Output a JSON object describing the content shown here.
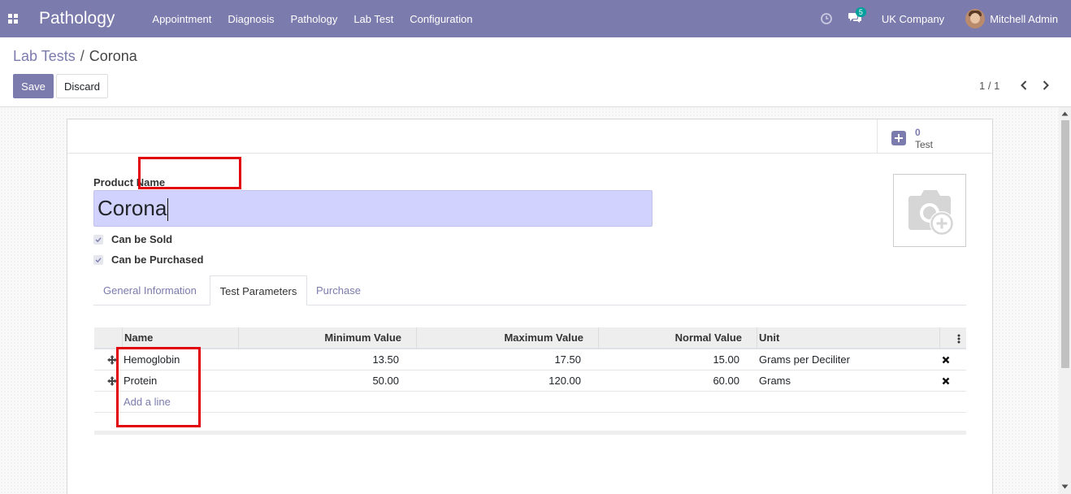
{
  "navbar": {
    "app_title": "Pathology",
    "menu": [
      "Appointment",
      "Diagnosis",
      "Pathology",
      "Lab Test",
      "Configuration"
    ],
    "chat_count": "5",
    "company": "UK Company",
    "user": "Mitchell Admin",
    "icons": {
      "apps": "apps-grid-icon",
      "activity": "clock-icon",
      "messages": "chat-icon"
    }
  },
  "control_panel": {
    "breadcrumb_parent": "Lab Tests",
    "breadcrumb_separator": "/",
    "breadcrumb_current": "Corona",
    "save_label": "Save",
    "discard_label": "Discard",
    "pager": "1 / 1"
  },
  "form": {
    "stat_button": {
      "value": "0",
      "label": "Test"
    },
    "product_name_label": "Product Name",
    "product_name": "Corona",
    "can_be_sold_label": "Can be Sold",
    "can_be_sold": true,
    "can_be_purchased_label": "Can be Purchased",
    "can_be_purchased": true,
    "tabs": [
      "General Information",
      "Test Parameters",
      "Purchase"
    ],
    "active_tab": "Test Parameters"
  },
  "parameters_table": {
    "columns": [
      "Name",
      "Minimum Value",
      "Maximum Value",
      "Normal Value",
      "Unit"
    ],
    "rows": [
      {
        "name": "Hemoglobin",
        "min": "13.50",
        "max": "17.50",
        "normal": "15.00",
        "unit": "Grams per Deciliter"
      },
      {
        "name": "Protein",
        "min": "50.00",
        "max": "120.00",
        "normal": "60.00",
        "unit": "Grams"
      }
    ],
    "add_line_label": "Add a line"
  },
  "colors": {
    "brand": "#7c7bad",
    "name_input_bg": "#d2d2ff",
    "highlight": "#e2010a"
  }
}
